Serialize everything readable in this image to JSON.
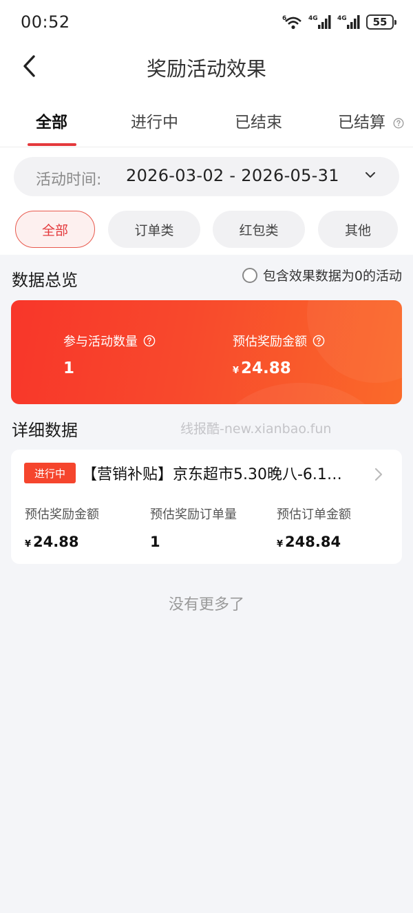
{
  "status_bar": {
    "time": "00:52",
    "wifi_label": "6",
    "signal1_label": "4G",
    "signal2_label": "4G",
    "battery": "55"
  },
  "nav": {
    "title": "奖励活动效果",
    "back_icon": "chevron-left-icon"
  },
  "tabs": [
    {
      "label": "全部",
      "active": true
    },
    {
      "label": "进行中",
      "active": false
    },
    {
      "label": "已结束",
      "active": false
    },
    {
      "label": "已结算",
      "active": false,
      "help_icon": "question-circle-icon"
    }
  ],
  "date_filter": {
    "label": "活动时间:",
    "value": "2026-03-02 - 2026-05-31",
    "icon": "chevron-down-icon"
  },
  "category_chips": [
    {
      "label": "全部",
      "active": true
    },
    {
      "label": "订单类",
      "active": false
    },
    {
      "label": "红包类",
      "active": false
    },
    {
      "label": "其他",
      "active": false
    }
  ],
  "overview": {
    "title": "数据总览",
    "include_zero_label": "包含效果数据为0的活动",
    "include_zero_checked": false,
    "activity_count_label": "参与活动数量",
    "activity_count": "1",
    "estimated_reward_label": "预估奖励金额",
    "currency": "¥",
    "estimated_reward": "24.88"
  },
  "details": {
    "title": "详细数据",
    "watermark": "线报酷-new.xianbao.fun",
    "items": [
      {
        "status": "进行中",
        "title": "【营销补贴】京东超市5.30晚八-6.1…",
        "reward_label": "预估奖励金额",
        "reward_value": "24.88",
        "order_count_label": "预估奖励订单量",
        "order_count_value": "1",
        "order_amount_label": "预估订单金额",
        "order_amount_value": "248.84"
      }
    ],
    "no_more": "没有更多了"
  },
  "colors": {
    "accent": "#e4393c",
    "card_gradient_start": "#f8362a",
    "card_gradient_end": "#fa6a2a",
    "badge": "#f5452d",
    "page_bg": "#f4f5f8"
  }
}
